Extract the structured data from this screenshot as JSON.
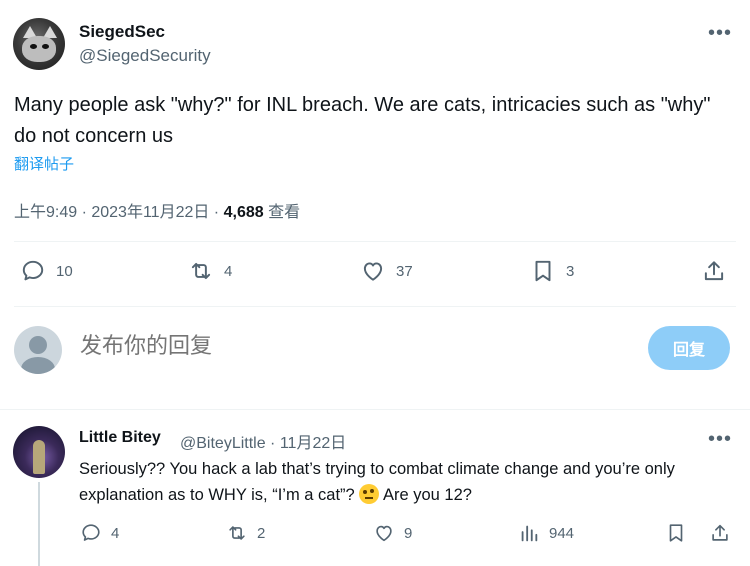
{
  "tweet": {
    "display_name": "SiegedSec",
    "handle": "@SiegedSecurity",
    "text": "Many people ask \"why?\" for INL breach. We are cats, intricacies such as \"why\" do not concern us",
    "translate_label": "翻译帖子",
    "time": "上午9:49 · 2023年11月22日 · ",
    "views_count": "4,688",
    "views_label": " 查看",
    "more_label": "•••",
    "actions": {
      "replies": "10",
      "retweets": "4",
      "likes": "37",
      "bookmarks": "3"
    }
  },
  "composer": {
    "placeholder": "发布你的回复",
    "reply_button": "回复"
  },
  "reply": {
    "display_name": "Little Bitey",
    "handle_meta": "@BiteyLittle · 11月22日",
    "text_before_emoji": "Seriously?? You hack a lab that’s trying to combat climate change and you’re only explanation as to WHY is, “I’m a cat”? ",
    "text_after_emoji": " Are you 12?",
    "more_label": "•••",
    "actions": {
      "replies": "4",
      "retweets": "2",
      "likes": "9",
      "views": "944"
    }
  },
  "colors": {
    "accent": "#1d9bf0",
    "secondary_text": "#536471",
    "reply_button_disabled": "#8ecdf8"
  }
}
